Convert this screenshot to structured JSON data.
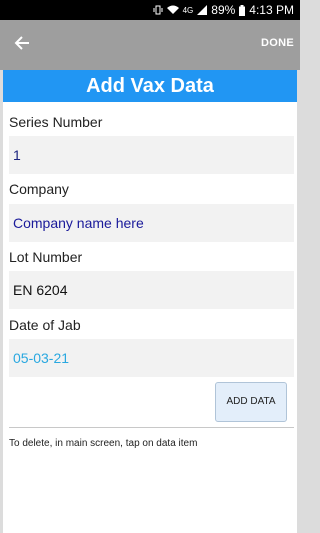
{
  "status_bar": {
    "battery": "89%",
    "time": "4:13 PM",
    "network": "4G"
  },
  "app_bar": {
    "done_label": "DONE"
  },
  "form": {
    "title": "Add Vax Data",
    "series_label": "Series Number",
    "series_value": "1",
    "company_label": "Company",
    "company_value": "Company name here",
    "lot_label": "Lot Number",
    "lot_value": "EN 6204",
    "date_label": "Date of Jab",
    "date_value": "05-03-21",
    "add_button_label": "ADD DATA",
    "hint_text": "To delete, in main screen, tap on data item"
  }
}
